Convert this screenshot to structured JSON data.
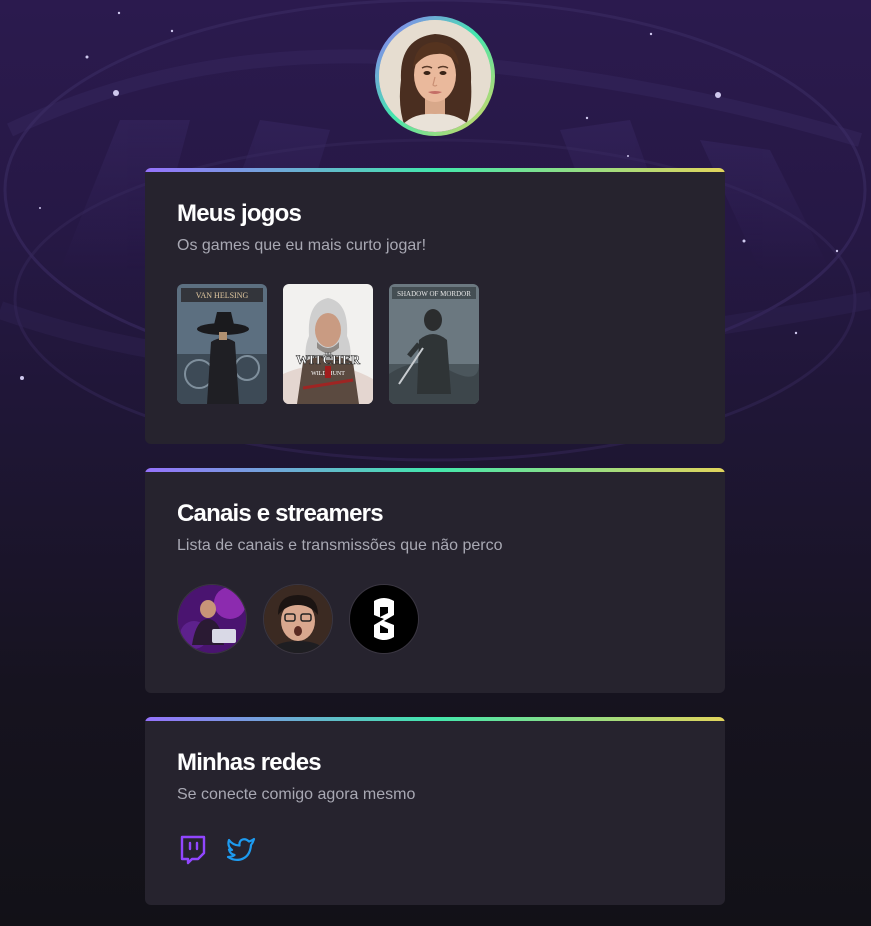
{
  "profile": {
    "avatar_alt": "profile-photo"
  },
  "colors": {
    "accent_gradient": [
      "#9572fc",
      "#43e7ad",
      "#e2d45c"
    ],
    "card_bg": "#26232e",
    "text_muted": "#a8a8b3",
    "twitch": "#9146ff",
    "twitter": "#1d9bf0"
  },
  "games_card": {
    "title": "Meus jogos",
    "subtitle": "Os games que eu mais curto jogar!",
    "games": [
      {
        "name": "Van Helsing",
        "cover_label": "VAN HELSING"
      },
      {
        "name": "The Witcher 3: Wild Hunt",
        "cover_label": "WITCHER",
        "cover_sub": "WILD HUNT",
        "cover_top": "THE"
      },
      {
        "name": "Shadow of Mordor",
        "cover_label": "SHADOW OF MORDOR"
      }
    ]
  },
  "channels_card": {
    "title": "Canais e streamers",
    "subtitle": "Lista de canais e transmissões que não perco",
    "channels": [
      {
        "name": "channel-1"
      },
      {
        "name": "channel-2"
      },
      {
        "name": "channel-3"
      }
    ]
  },
  "socials_card": {
    "title": "Minhas redes",
    "subtitle": "Se conecte comigo agora mesmo",
    "links": [
      {
        "icon": "twitch-icon"
      },
      {
        "icon": "twitter-icon"
      }
    ]
  }
}
